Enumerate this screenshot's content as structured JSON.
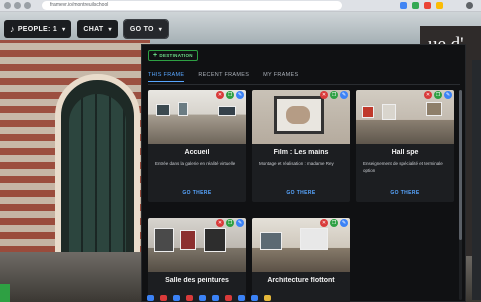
{
  "browser": {
    "url": "framevr.io/montreuilschool"
  },
  "toolbar": {
    "people_label": "PEOPLE: 1",
    "chat_label": "CHAT",
    "goto_label": "GO TO"
  },
  "scene": {
    "wall_sign": "ue d'"
  },
  "panel": {
    "destination_button": "DESTINATION",
    "tabs": [
      {
        "label": "THIS FRAME",
        "active": true
      },
      {
        "label": "RECENT FRAMES",
        "active": false
      },
      {
        "label": "MY FRAMES",
        "active": false
      }
    ],
    "go_there_label": "GO THERE",
    "cards": [
      {
        "title": "Accueil",
        "description": "Entrée dans la galerie en réalité virtuelle"
      },
      {
        "title": "Film : Les mains",
        "description": "Montage et réalisation : madame Rey"
      },
      {
        "title": "Hall spe",
        "description": "Enseignement de spécialité et terminale option"
      },
      {
        "title": "Salle des peintures",
        "description": ""
      },
      {
        "title": "Architecture flottont",
        "description": ""
      }
    ]
  },
  "colors": {
    "accent": "#58a6ff",
    "destination_green": "#2ea043",
    "delete_red": "#d93a3a",
    "edit_blue": "#3b82f6",
    "panel_bg": "#101113",
    "card_bg": "#1c1e21"
  },
  "icons": {
    "people": "music-note-icon",
    "delete": "trash-icon",
    "duplicate": "copy-icon",
    "edit": "pencil-icon",
    "dropdown": "chevron-down-icon",
    "add": "plus-icon"
  }
}
